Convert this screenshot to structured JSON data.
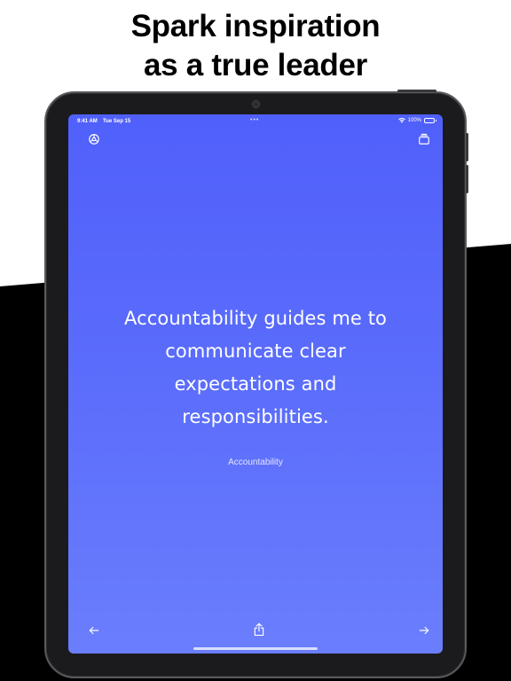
{
  "marketing": {
    "headline_line1": "Spark inspiration",
    "headline_line2": "as a true leader"
  },
  "status_bar": {
    "time": "9:41 AM",
    "date": "Tue Sep 15",
    "battery": "100%",
    "icons": [
      "wifi-icon",
      "battery-icon"
    ]
  },
  "toolbar": {
    "left_icon": "gear-icon",
    "right_icon": "stacked-cards-icon"
  },
  "card": {
    "quote": "Accountability guides me to communicate clear expectations and responsibilities.",
    "category": "Accountability"
  },
  "bottom_bar": {
    "back_icon": "arrow-left-icon",
    "share_icon": "share-icon",
    "next_icon": "arrow-right-icon"
  },
  "colors": {
    "screen_gradient_top": "#5060fb",
    "screen_gradient_bottom": "#6a7efd",
    "band": "#000000",
    "text": "#ffffff"
  }
}
